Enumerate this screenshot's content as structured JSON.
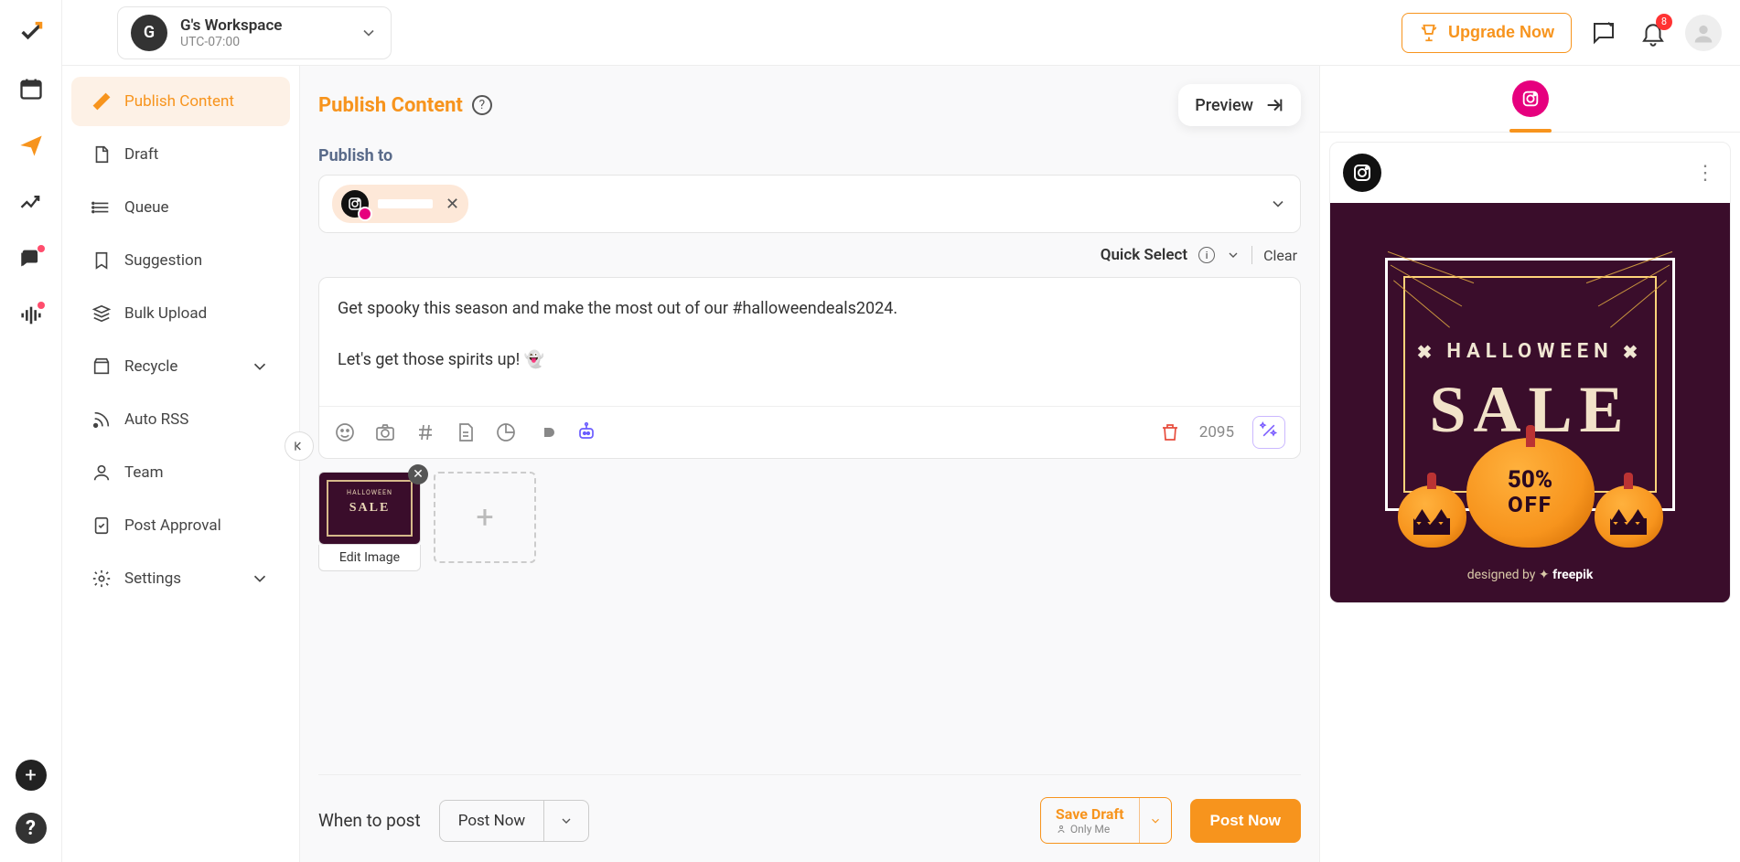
{
  "workspace": {
    "avatar_letter": "G",
    "name": "G's Workspace",
    "timezone": "UTC-07:00"
  },
  "header": {
    "upgrade_label": "Upgrade Now",
    "notification_count": "8"
  },
  "sidebar": {
    "items": [
      {
        "label": "Publish Content"
      },
      {
        "label": "Draft"
      },
      {
        "label": "Queue"
      },
      {
        "label": "Suggestion"
      },
      {
        "label": "Bulk Upload"
      },
      {
        "label": "Recycle"
      },
      {
        "label": "Auto RSS"
      },
      {
        "label": "Team"
      },
      {
        "label": "Post Approval"
      },
      {
        "label": "Settings"
      }
    ]
  },
  "page": {
    "title": "Publish Content",
    "preview_button": "Preview",
    "publish_to_label": "Publish to",
    "quick_select_label": "Quick Select",
    "clear_label": "Clear",
    "composer_text": "Get spooky this season and make the most out of our #halloweendeals2024.\n\nLet's get those spirits up! 👻",
    "char_remaining": "2095",
    "edit_image_label": "Edit Image",
    "when_to_post_label": "When to post",
    "when_to_post_value": "Post Now",
    "save_draft_label": "Save Draft",
    "save_draft_sub": "Only Me",
    "post_now_button": "Post Now"
  },
  "preview_image": {
    "halloween_text": "HALLOWEEN",
    "sale_text": "SALE",
    "discount_pct": "50%",
    "discount_off": "OFF",
    "credit_prefix": "designed by",
    "credit_brand": "freepik"
  },
  "thumb": {
    "hall": "HALLOWEEN",
    "sale": "SALE"
  }
}
